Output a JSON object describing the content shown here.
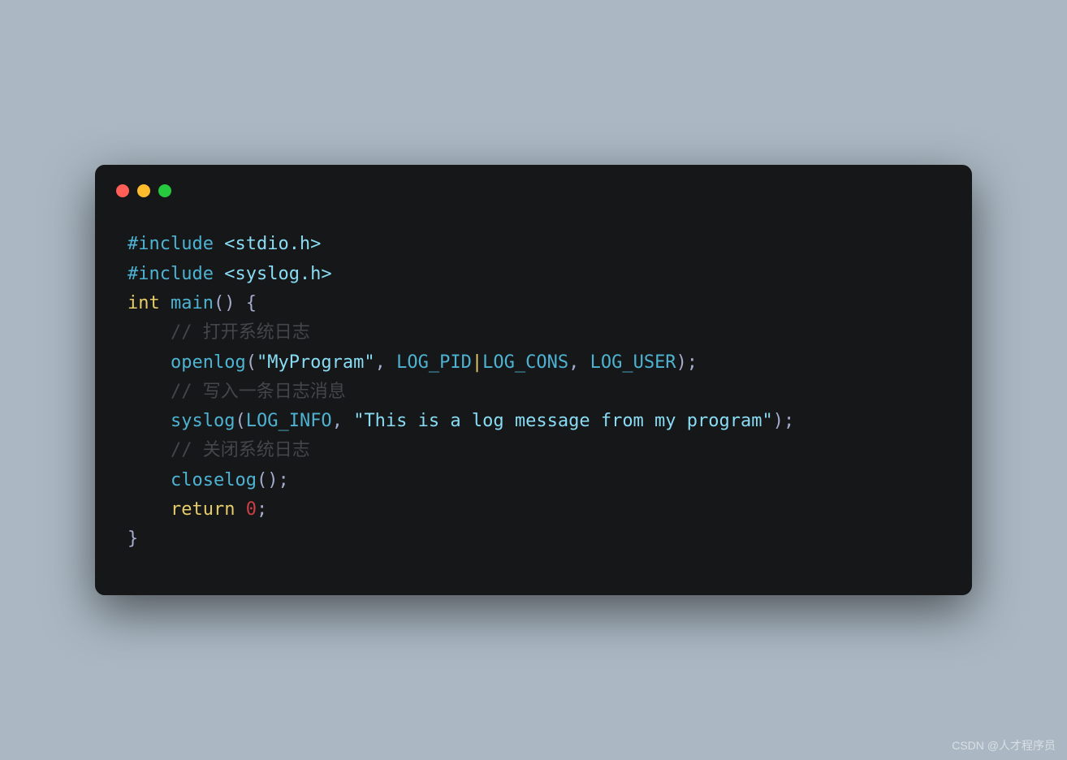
{
  "code": {
    "lines": [
      {
        "tokens": [
          {
            "t": "#include ",
            "cls": "c-directive"
          },
          {
            "t": "<stdio.h>",
            "cls": "c-string"
          }
        ]
      },
      {
        "tokens": [
          {
            "t": "#include ",
            "cls": "c-directive"
          },
          {
            "t": "<syslog.h>",
            "cls": "c-string"
          }
        ]
      },
      {
        "tokens": [
          {
            "t": "",
            "cls": ""
          }
        ]
      },
      {
        "tokens": [
          {
            "t": "int",
            "cls": "c-keyword"
          },
          {
            "t": " ",
            "cls": ""
          },
          {
            "t": "main",
            "cls": "c-func"
          },
          {
            "t": "() {",
            "cls": "c-punct"
          }
        ]
      },
      {
        "tokens": [
          {
            "t": "    ",
            "cls": ""
          },
          {
            "t": "// 打开系统日志",
            "cls": "c-comment"
          }
        ]
      },
      {
        "tokens": [
          {
            "t": "    ",
            "cls": ""
          },
          {
            "t": "openlog",
            "cls": "c-func"
          },
          {
            "t": "(",
            "cls": "c-punct"
          },
          {
            "t": "\"MyProgram\"",
            "cls": "c-string"
          },
          {
            "t": ", ",
            "cls": "c-punct"
          },
          {
            "t": "LOG_PID",
            "cls": "c-const"
          },
          {
            "t": "|",
            "cls": "c-pipe"
          },
          {
            "t": "LOG_CONS",
            "cls": "c-const"
          },
          {
            "t": ", ",
            "cls": "c-punct"
          },
          {
            "t": "LOG_USER",
            "cls": "c-const"
          },
          {
            "t": ");",
            "cls": "c-punct"
          }
        ]
      },
      {
        "tokens": [
          {
            "t": "",
            "cls": ""
          }
        ]
      },
      {
        "tokens": [
          {
            "t": "    ",
            "cls": ""
          },
          {
            "t": "// 写入一条日志消息",
            "cls": "c-comment"
          }
        ]
      },
      {
        "tokens": [
          {
            "t": "    ",
            "cls": ""
          },
          {
            "t": "syslog",
            "cls": "c-func"
          },
          {
            "t": "(",
            "cls": "c-punct"
          },
          {
            "t": "LOG_INFO",
            "cls": "c-const"
          },
          {
            "t": ", ",
            "cls": "c-punct"
          },
          {
            "t": "\"This is a log message from my program\"",
            "cls": "c-string"
          },
          {
            "t": ");",
            "cls": "c-punct"
          }
        ]
      },
      {
        "tokens": [
          {
            "t": "",
            "cls": ""
          }
        ]
      },
      {
        "tokens": [
          {
            "t": "    ",
            "cls": ""
          },
          {
            "t": "// 关闭系统日志",
            "cls": "c-comment"
          }
        ]
      },
      {
        "tokens": [
          {
            "t": "    ",
            "cls": ""
          },
          {
            "t": "closelog",
            "cls": "c-func"
          },
          {
            "t": "();",
            "cls": "c-punct"
          }
        ]
      },
      {
        "tokens": [
          {
            "t": "",
            "cls": ""
          }
        ]
      },
      {
        "tokens": [
          {
            "t": "    ",
            "cls": ""
          },
          {
            "t": "return",
            "cls": "c-keyword"
          },
          {
            "t": " ",
            "cls": ""
          },
          {
            "t": "0",
            "cls": "c-number"
          },
          {
            "t": ";",
            "cls": "c-punct"
          }
        ]
      },
      {
        "tokens": [
          {
            "t": "}",
            "cls": "c-punct"
          }
        ]
      }
    ]
  },
  "watermark": "CSDN @人才程序员"
}
